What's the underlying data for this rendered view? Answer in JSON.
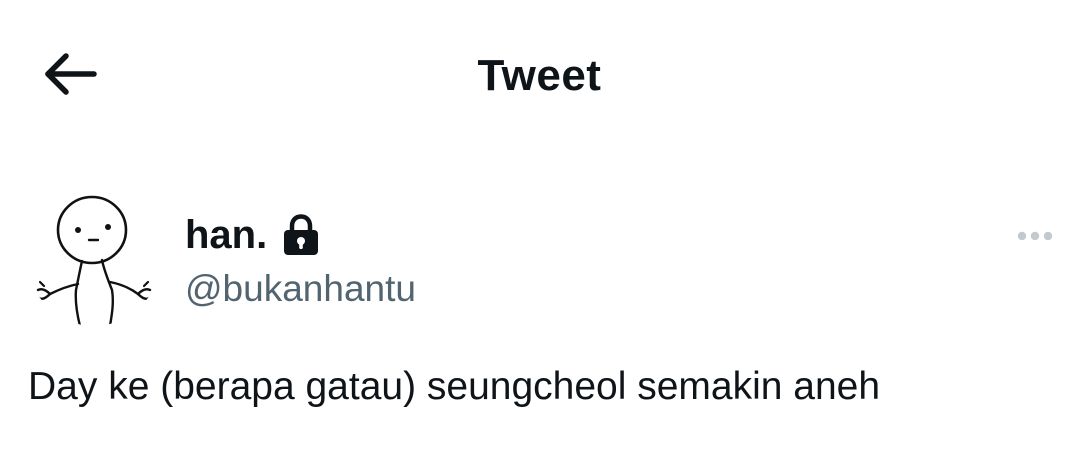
{
  "header": {
    "back_icon": "arrow-left-icon",
    "title": "Tweet"
  },
  "tweet": {
    "author": {
      "display_name": "han.",
      "handle": "@bukanhantu",
      "protected_icon": "lock-icon",
      "avatar": "shrugging-doodle-avatar"
    },
    "more_icon": "more-horizontal-icon",
    "text": "Day ke (berapa gatau) seungcheol semakin aneh"
  },
  "colors": {
    "text_primary": "#0f1419",
    "text_secondary": "#536471",
    "icon_muted": "#c4c9ce",
    "background": "#ffffff"
  }
}
